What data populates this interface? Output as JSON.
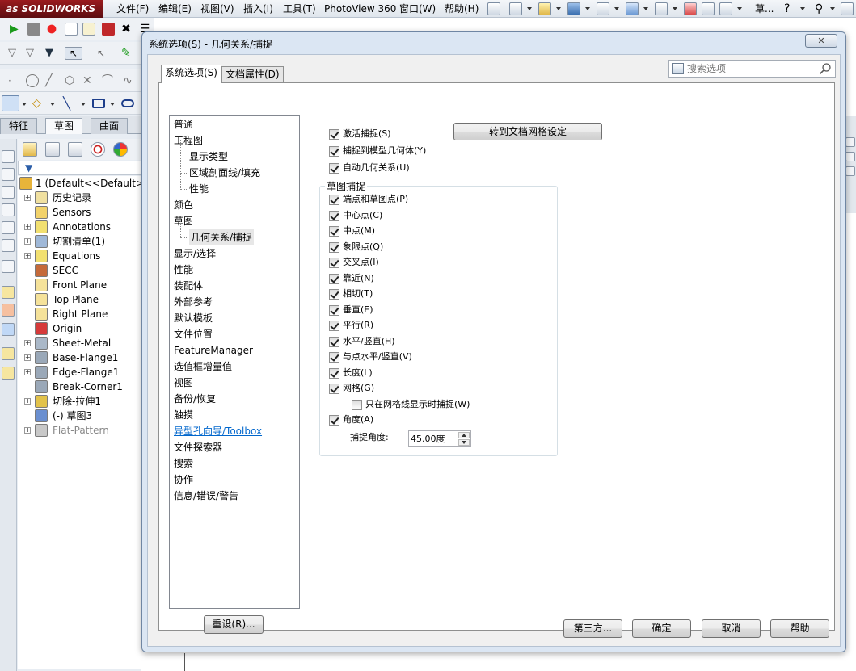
{
  "app": {
    "logo": "SOLIDWORKS"
  },
  "menu": [
    "文件(F)",
    "编辑(E)",
    "视图(V)",
    "插入(I)",
    "工具(T)",
    "PhotoView 360",
    "窗口(W)",
    "帮助(H)"
  ],
  "menu_right_label": "草...",
  "command_tabs": [
    "特征",
    "草图",
    "曲面"
  ],
  "feature_tree": [
    {
      "label": "1  (Default<<Default>",
      "icon": "part-icon"
    },
    {
      "label": "历史记录",
      "icon": "history-icon",
      "expand": true
    },
    {
      "label": "Sensors",
      "icon": "sensor-icon"
    },
    {
      "label": "Annotations",
      "icon": "annotation-icon",
      "expand": true
    },
    {
      "label": "切割清单(1)",
      "icon": "cutlist-icon",
      "expand": true
    },
    {
      "label": "Equations",
      "icon": "equation-icon",
      "expand": true
    },
    {
      "label": "SECC",
      "icon": "material-icon"
    },
    {
      "label": "Front Plane",
      "icon": "plane-icon"
    },
    {
      "label": "Top Plane",
      "icon": "plane-icon"
    },
    {
      "label": "Right Plane",
      "icon": "plane-icon"
    },
    {
      "label": "Origin",
      "icon": "origin-icon"
    },
    {
      "label": "Sheet-Metal",
      "icon": "sheetmetal-icon",
      "expand": true
    },
    {
      "label": "Base-Flange1",
      "icon": "flange-icon",
      "expand": true
    },
    {
      "label": "Edge-Flange1",
      "icon": "flange-icon",
      "expand": true
    },
    {
      "label": "Break-Corner1",
      "icon": "corner-icon"
    },
    {
      "label": "切除-拉伸1",
      "icon": "cut-extrude-icon",
      "expand": true
    },
    {
      "label": "(-) 草图3",
      "icon": "sketch-icon"
    },
    {
      "label": "Flat-Pattern",
      "icon": "flatpattern-icon",
      "expand": true,
      "dim": true
    }
  ],
  "dialog": {
    "title": "系统选项(S) - 几何关系/捕捉",
    "close_label": "✕",
    "tabs": [
      "系统选项(S)",
      "文档属性(D)"
    ],
    "search_placeholder": "搜索选项",
    "nav": [
      {
        "label": "普通",
        "level": 0
      },
      {
        "label": "工程图",
        "level": 0
      },
      {
        "label": "显示类型",
        "level": 1
      },
      {
        "label": "区域剖面线/填充",
        "level": 1
      },
      {
        "label": "性能",
        "level": 1
      },
      {
        "label": "颜色",
        "level": 0
      },
      {
        "label": "草图",
        "level": 0
      },
      {
        "label": "几何关系/捕捉",
        "level": 1,
        "selected": true
      },
      {
        "label": "显示/选择",
        "level": 0
      },
      {
        "label": "性能",
        "level": 0
      },
      {
        "label": "装配体",
        "level": 0
      },
      {
        "label": "外部参考",
        "level": 0
      },
      {
        "label": "默认模板",
        "level": 0
      },
      {
        "label": "文件位置",
        "level": 0
      },
      {
        "label": "FeatureManager",
        "level": 0
      },
      {
        "label": "选值框增量值",
        "level": 0
      },
      {
        "label": "视图",
        "level": 0
      },
      {
        "label": "备份/恢复",
        "level": 0
      },
      {
        "label": "触摸",
        "level": 0
      },
      {
        "label": "异型孔向导/Toolbox",
        "level": 0,
        "link": true
      },
      {
        "label": "文件探索器",
        "level": 0
      },
      {
        "label": "搜索",
        "level": 0
      },
      {
        "label": "协作",
        "level": 0
      },
      {
        "label": "信息/错误/警告",
        "level": 0
      }
    ],
    "reset_label": "重设(R)...",
    "grid_button_label": "转到文档网格设定",
    "top_options": [
      {
        "label": "激活捕捉(S)",
        "checked": true
      },
      {
        "label": "捕捉到模型几何体(Y)",
        "checked": true
      },
      {
        "label": "自动几何关系(U)",
        "checked": true
      }
    ],
    "snap_group_title": "草图捕捉",
    "snap_options": [
      {
        "label": "端点和草图点(P)",
        "checked": true
      },
      {
        "label": "中心点(C)",
        "checked": true
      },
      {
        "label": "中点(M)",
        "checked": true
      },
      {
        "label": "象限点(Q)",
        "checked": true
      },
      {
        "label": "交叉点(I)",
        "checked": true
      },
      {
        "label": "靠近(N)",
        "checked": true
      },
      {
        "label": "相切(T)",
        "checked": true
      },
      {
        "label": "垂直(E)",
        "checked": true
      },
      {
        "label": "平行(R)",
        "checked": true
      },
      {
        "label": "水平/竖直(H)",
        "checked": true
      },
      {
        "label": "与点水平/竖直(V)",
        "checked": true
      },
      {
        "label": "长度(L)",
        "checked": true
      },
      {
        "label": "网格(G)",
        "checked": true
      },
      {
        "label": "只在网格线显示时捕捉(W)",
        "checked": false,
        "indent": true
      },
      {
        "label": "角度(A)",
        "checked": true
      }
    ],
    "snap_angle_label": "捕捉角度:",
    "snap_angle_value": "45.00度",
    "footer": [
      "第三方...",
      "确定",
      "取消",
      "帮助"
    ]
  }
}
